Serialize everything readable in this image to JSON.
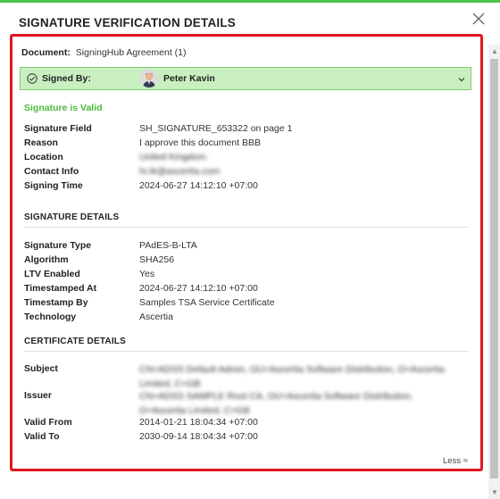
{
  "modal": {
    "title": "SIGNATURE VERIFICATION DETAILS"
  },
  "document": {
    "label": "Document:",
    "value": "SigningHub Agreement (1)"
  },
  "signed_by": {
    "label": "Signed By:",
    "name": "Peter Kavin"
  },
  "status": "Signature is Valid",
  "signature_info": [
    {
      "key": "Signature Field",
      "value": "SH_SIGNATURE_653322 on page 1"
    },
    {
      "key": "Reason",
      "value": "I approve this document BBB"
    },
    {
      "key": "Location",
      "value": "United Kingdom"
    },
    {
      "key": "Contact Info",
      "value": "hr.tk@ascertia.com"
    },
    {
      "key": "Signing Time",
      "value": "2024-06-27 14:12:10 +07:00"
    }
  ],
  "signature_details": {
    "heading": "SIGNATURE DETAILS",
    "rows": [
      {
        "key": "Signature Type",
        "value": "PAdES-B-LTA"
      },
      {
        "key": "Algorithm",
        "value": "SHA256"
      },
      {
        "key": "LTV Enabled",
        "value": "Yes"
      },
      {
        "key": "Timestamped At",
        "value": "2024-06-27 14:12:10 +07:00"
      },
      {
        "key": "Timestamp By",
        "value": "Samples TSA Service Certificate"
      },
      {
        "key": "Technology",
        "value": "Ascertia"
      }
    ]
  },
  "certificate_details": {
    "heading": "CERTIFICATE DETAILS",
    "rows": [
      {
        "key": "Subject",
        "value": "CN=ADSS Default Admin, OU=Ascertia Software Distribution, O=Ascertia Limited, C=GB"
      },
      {
        "key": "Issuer",
        "value": "CN=ADSS SAMPLE Root CA, OU=Ascertia Software Distribution, O=Ascertia Limited, C=GB"
      },
      {
        "key": "Valid From",
        "value": "2014-01-21 18:04:34 +07:00"
      },
      {
        "key": "Valid To",
        "value": "2030-09-14 18:04:34 +07:00"
      }
    ]
  },
  "less_label": "Less ≈",
  "colors": {
    "accent_green": "#4cc24a",
    "highlight_red": "#e3141e",
    "signed_bar_bg": "#c9efc0",
    "valid_green": "#4cbb3c"
  },
  "icons": {
    "close": "close-icon",
    "check": "check-circle-icon",
    "chevron": "chevron-down-icon",
    "avatar": "user-avatar"
  }
}
